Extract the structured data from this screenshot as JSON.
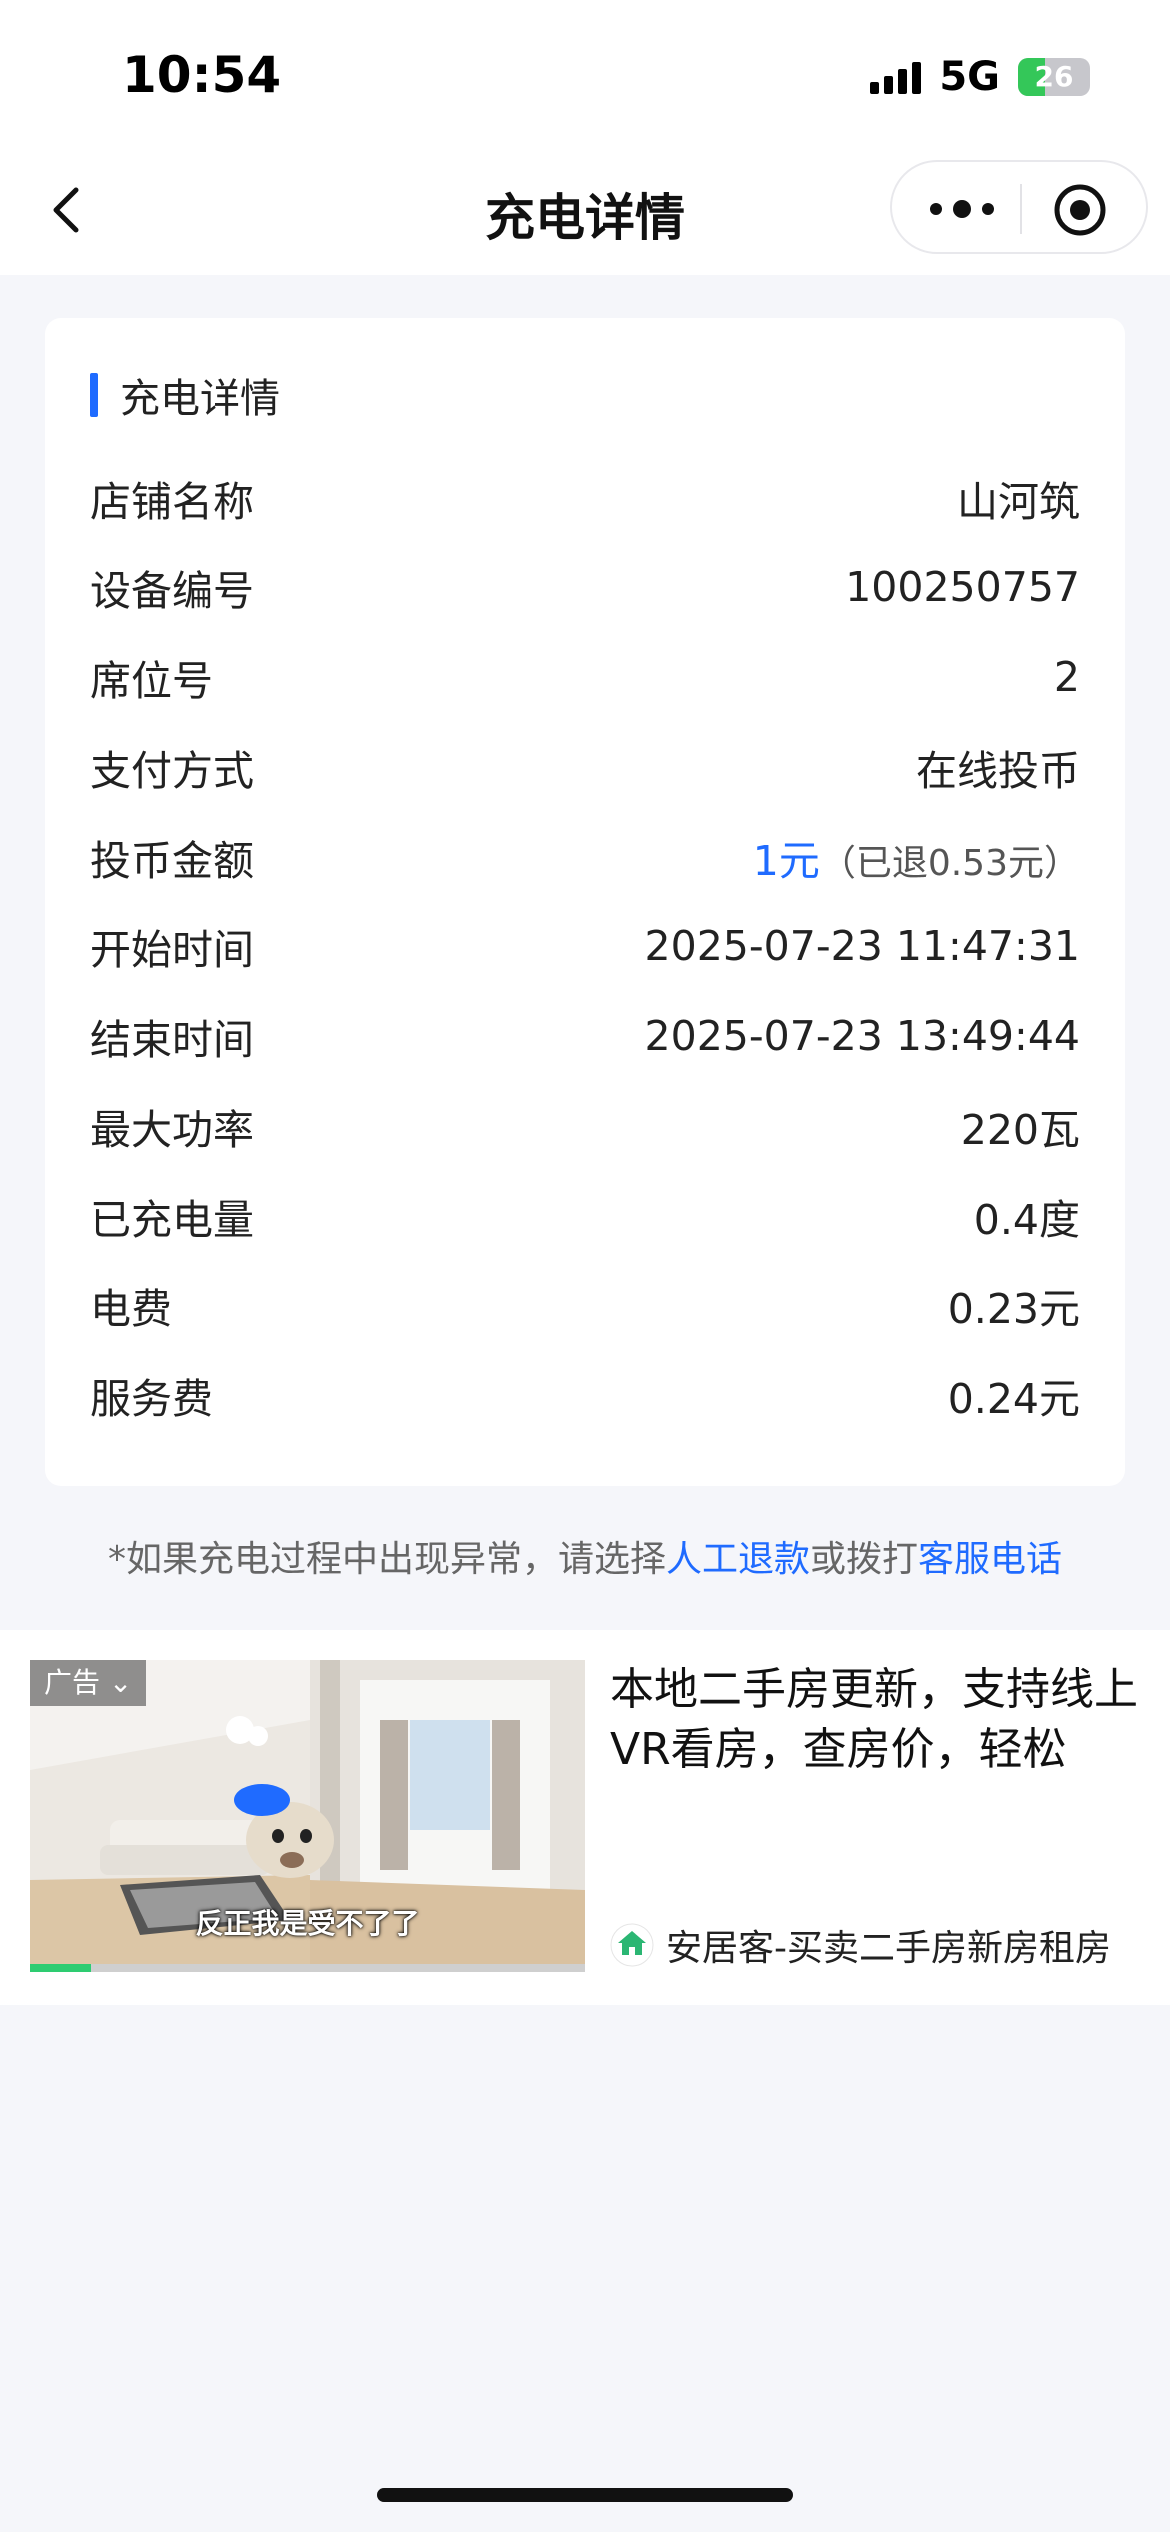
{
  "status_bar": {
    "time": "10:54",
    "network": "5G",
    "battery": "26"
  },
  "nav": {
    "title": "充电详情"
  },
  "card": {
    "title": "充电详情",
    "rows": [
      {
        "label": "店铺名称",
        "value": "山河筑"
      },
      {
        "label": "设备编号",
        "value": "100250757"
      },
      {
        "label": "席位号",
        "value": "2"
      },
      {
        "label": "支付方式",
        "value": "在线投币"
      },
      {
        "label": "投币金额",
        "value": "1元",
        "note": "（已退0.53元）"
      },
      {
        "label": "开始时间",
        "value": "2025-07-23 11:47:31"
      },
      {
        "label": "结束时间",
        "value": "2025-07-23 13:49:44"
      },
      {
        "label": "最大功率",
        "value": "220瓦"
      },
      {
        "label": "已充电量",
        "value": "0.4度"
      },
      {
        "label": "电费",
        "value": "0.23元"
      },
      {
        "label": "服务费",
        "value": "0.24元"
      }
    ]
  },
  "note": {
    "prefix": "*如果充电过程中出现异常，请选择",
    "link1": "人工退款",
    "middle": "或拨打",
    "link2": "客服电话"
  },
  "ad": {
    "tag": "广告",
    "caption": "反正我是受不了了",
    "progress_fraction": 0.11,
    "title": "本地二手房更新，支持线上VR看房，查房价，轻松",
    "source": "安居客-买卖二手房新房租房",
    "accent_color": "#2ecc71"
  },
  "colors": {
    "accent": "#1f6bff",
    "background": "#f5f6fa"
  }
}
